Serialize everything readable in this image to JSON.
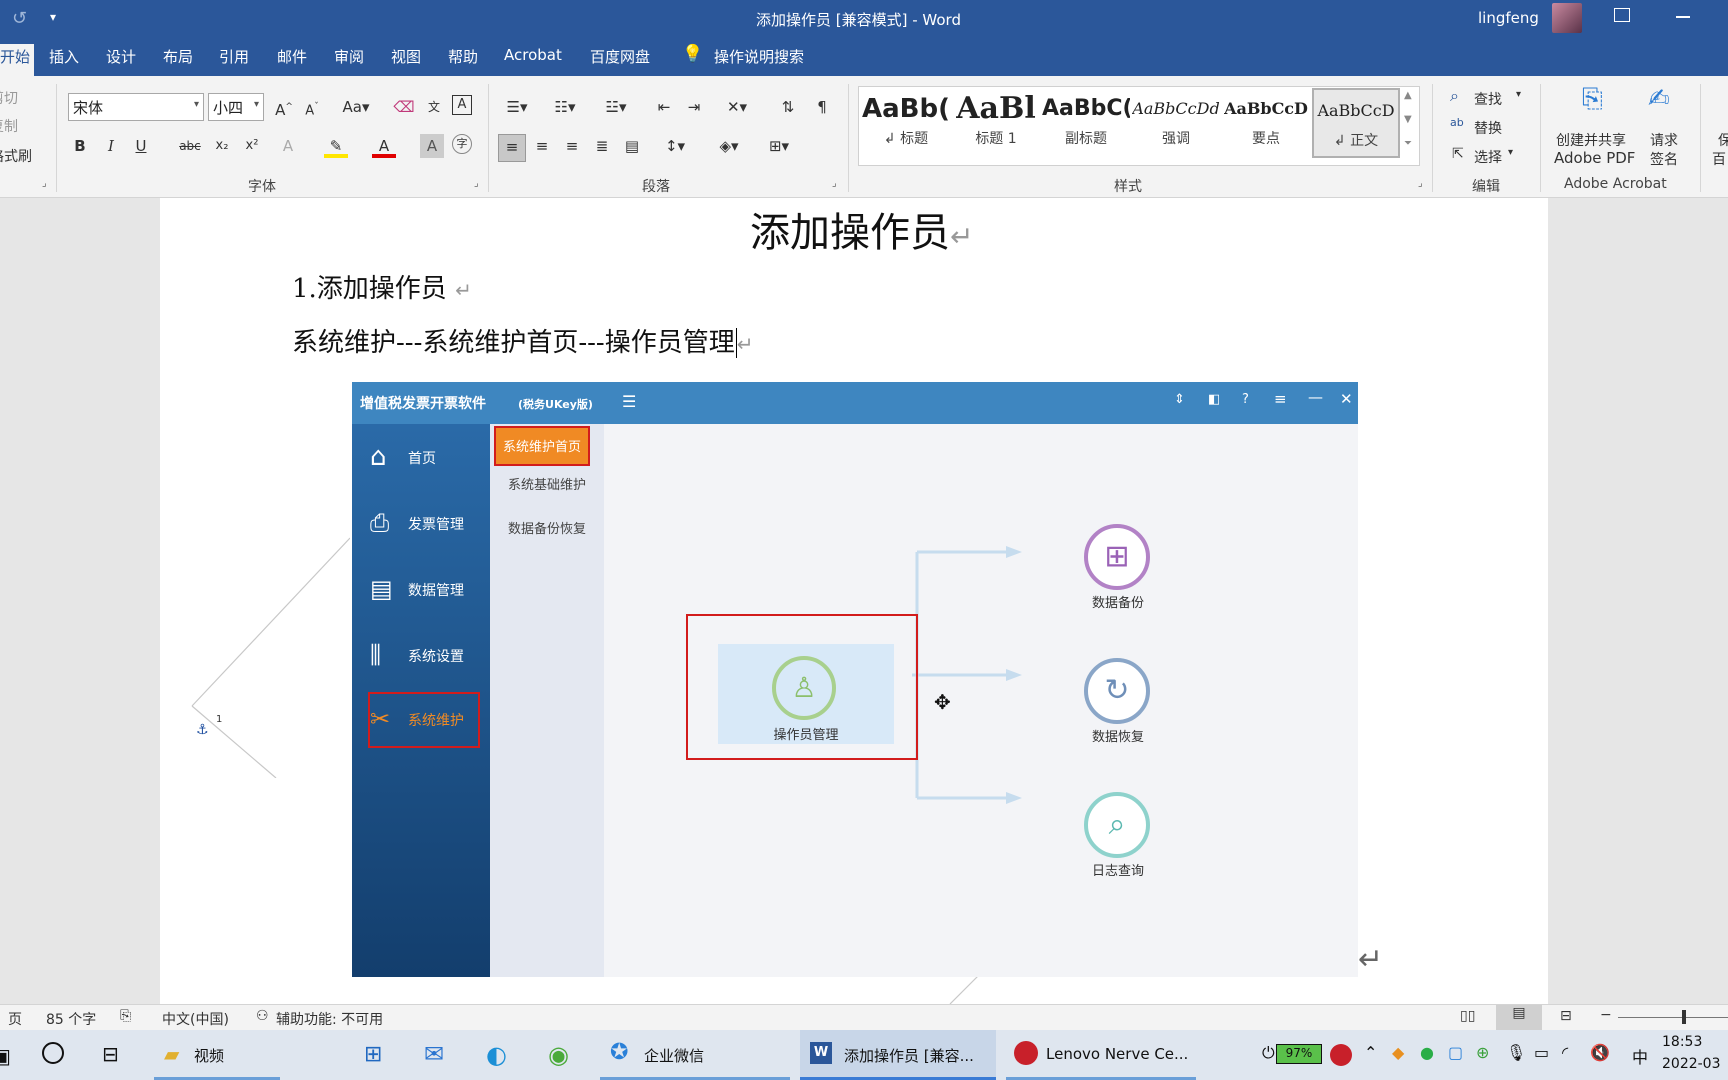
{
  "window": {
    "title": "添加操作员 [兼容模式]  -  Word",
    "user": "lingfeng"
  },
  "ribbon": {
    "tabs": [
      "开始",
      "插入",
      "设计",
      "布局",
      "引用",
      "邮件",
      "审阅",
      "视图",
      "帮助",
      "Acrobat",
      "百度网盘"
    ],
    "search_hint": "操作说明搜索",
    "clipboard": {
      "cut": "剪切",
      "copy": "复制",
      "painter": "格式刷"
    },
    "font": {
      "name": "宋体",
      "size": "小四",
      "group_label": "字体"
    },
    "paragraph": {
      "group_label": "段落"
    },
    "styles": {
      "group_label": "样式",
      "items": [
        {
          "sample": "AaBb(",
          "name": "↲ 标题"
        },
        {
          "sample": "AaBl",
          "name": "标题 1"
        },
        {
          "sample": "AaBbC(",
          "name": "副标题"
        },
        {
          "sample": "AaBbCcDd",
          "name": "强调"
        },
        {
          "sample": "AaBbCcD",
          "name": "要点"
        },
        {
          "sample": "AaBbCcD",
          "name": "↲ 正文"
        }
      ]
    },
    "editing": {
      "find": "查找",
      "replace": "替换",
      "select": "选择",
      "group_label": "编辑"
    },
    "acrobat": {
      "create_line1": "创建并共享",
      "create_line2": "Adobe PDF",
      "sign_line1": "请求",
      "sign_line2": "签名",
      "group_label": "Adobe Acrobat",
      "more_line1": "保",
      "more_line2": "百"
    }
  },
  "document": {
    "title": "添加操作员",
    "heading1": "1.添加操作员",
    "path_text": "系统维护---系统维护首页---操作员管理",
    "return_mark": "↵",
    "side_marker": "1"
  },
  "embedded_app": {
    "title": "增值税发票开票软件",
    "subtitle": "(税务UKey版)",
    "sidebar": [
      "首页",
      "发票管理",
      "数据管理",
      "系统设置",
      "系统维护"
    ],
    "submenu": [
      "系统维护首页",
      "系统基础维护",
      "数据备份恢复"
    ],
    "center_node": "操作员管理",
    "nodes": [
      "数据备份",
      "数据恢复",
      "日志查询"
    ],
    "colors": {
      "header": "#3e86c0",
      "highlight_orange": "#f08a24",
      "red_box": "#d21c1c"
    }
  },
  "statusbar": {
    "page": "页",
    "word_count": "85 个字",
    "language": "中文(中国)",
    "accessibility": "辅助功能: 不可用"
  },
  "taskbar": {
    "items": [
      "视频",
      "企业微信",
      "添加操作员 [兼容...",
      "Lenovo Nerve Ce..."
    ],
    "battery": "97%",
    "ime": "中",
    "time": "18:53",
    "date": "2022-03"
  }
}
